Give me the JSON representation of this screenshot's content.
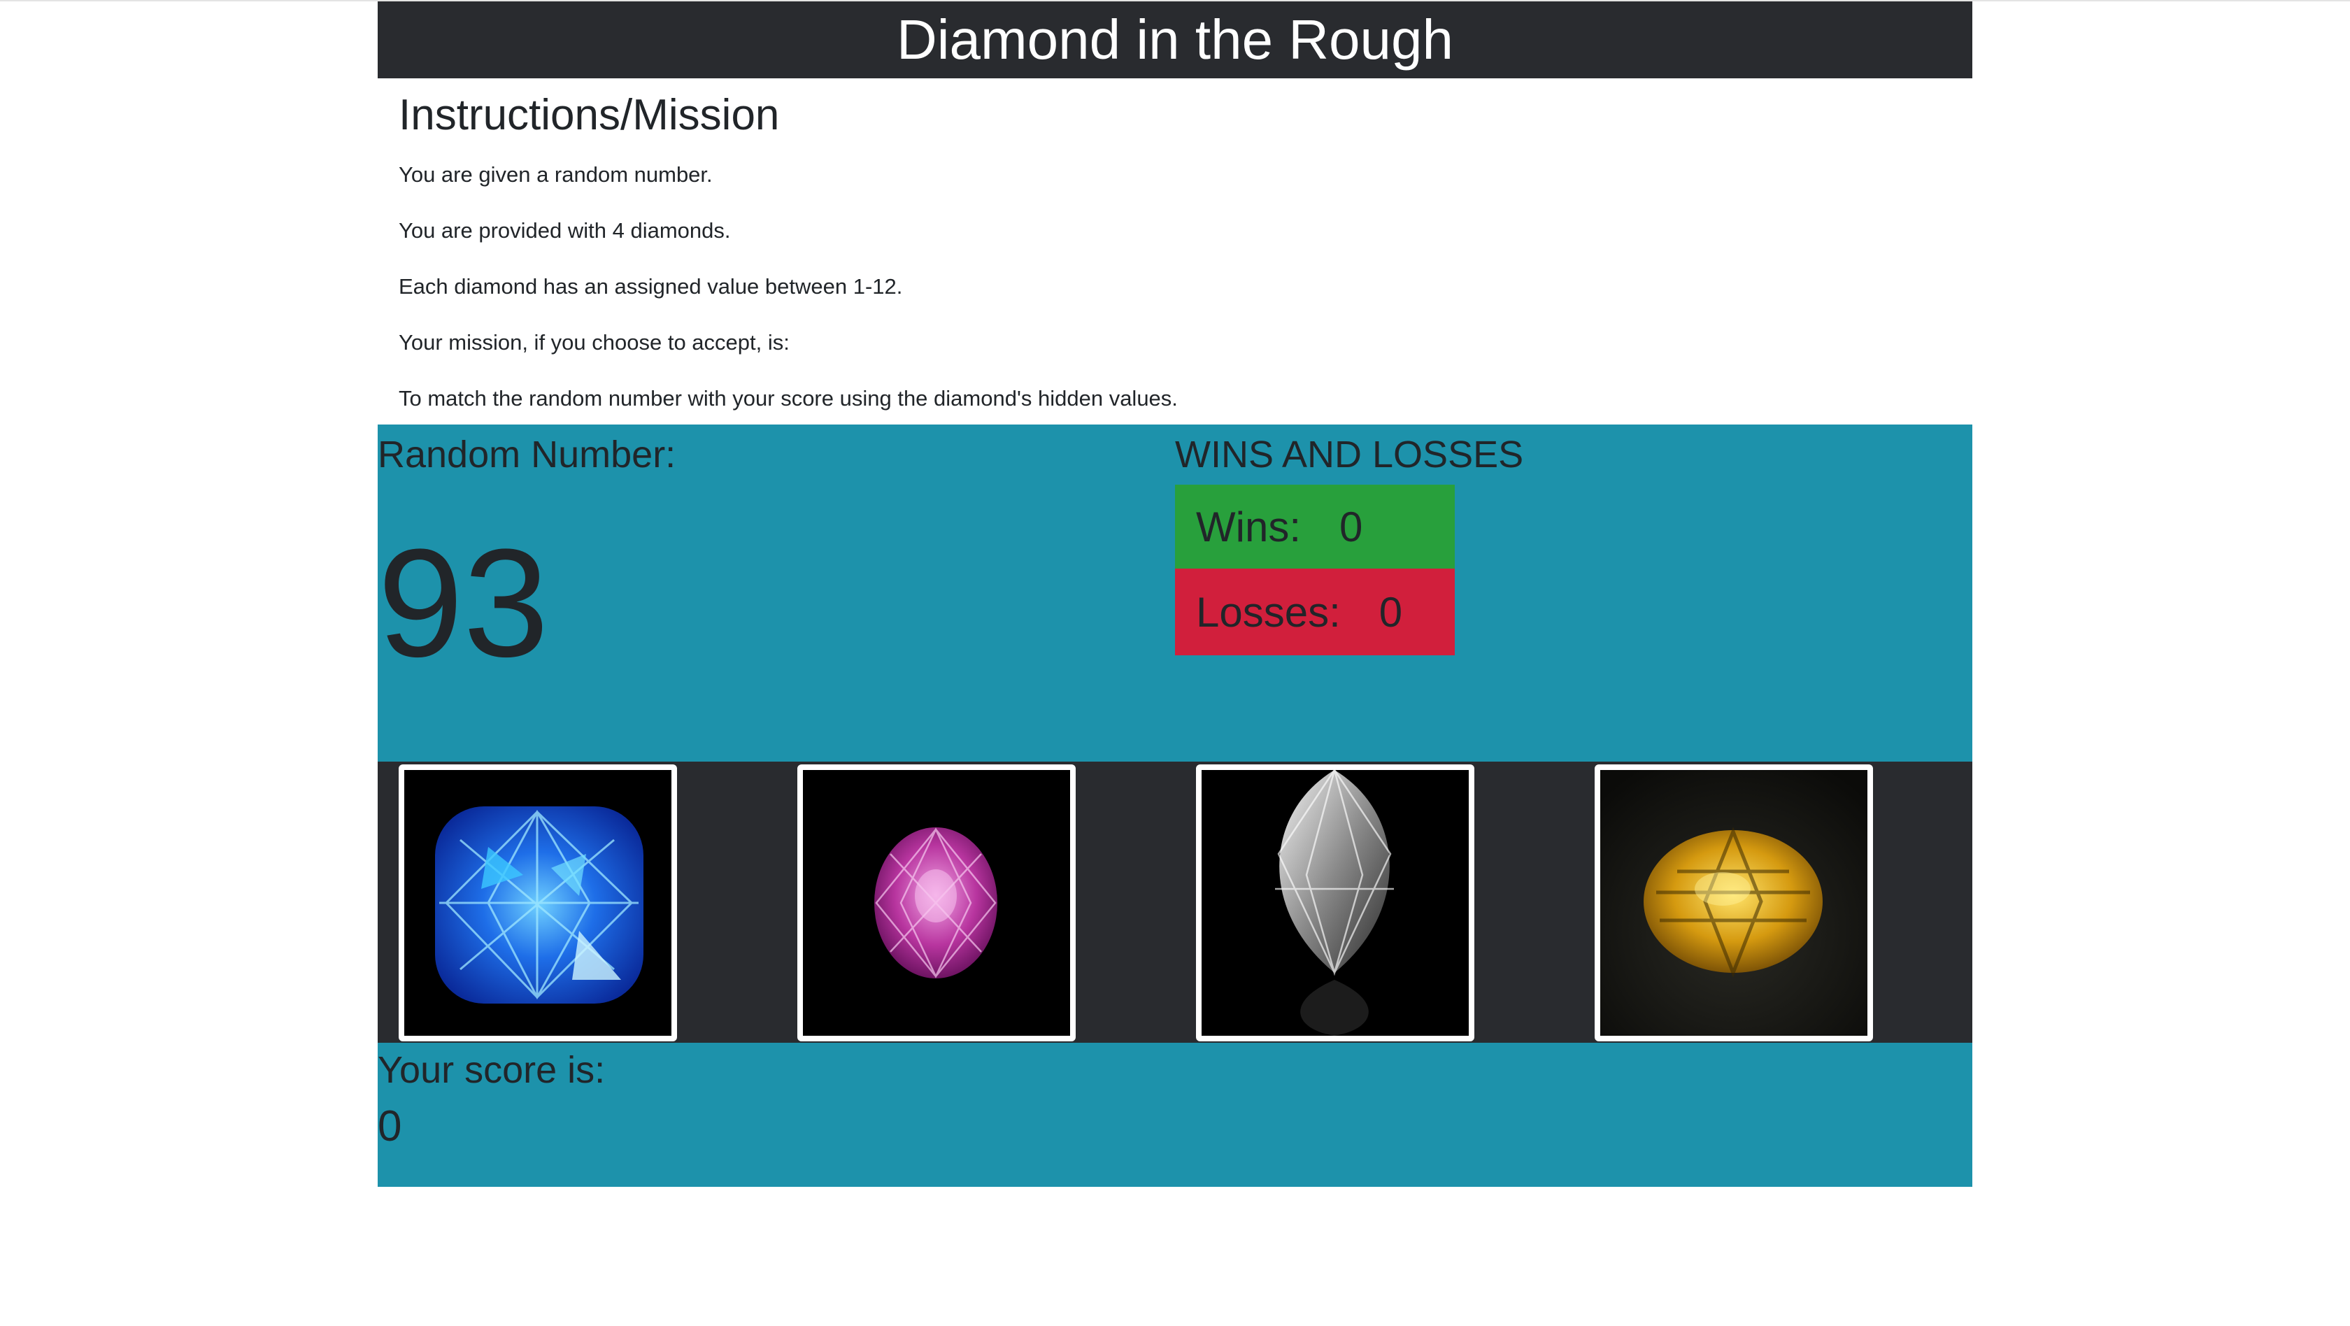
{
  "header": {
    "title": "Diamond in the Rough"
  },
  "instructions": {
    "heading": "Instructions/Mission",
    "lines": [
      "You are given a random number.",
      "You are provided with 4 diamonds.",
      "Each diamond has an assigned value between 1-12.",
      "Your mission, if you choose to accept, is:",
      "To match the random number with your score using the diamond's hidden values."
    ]
  },
  "random": {
    "label": "Random Number:",
    "value": "93"
  },
  "record": {
    "title": "WINS AND LOSSES",
    "wins_label": "Wins:",
    "wins_value": "0",
    "losses_label": "Losses:",
    "losses_value": "0"
  },
  "gems": [
    {
      "name": "blue-cushion-diamond"
    },
    {
      "name": "pink-oval-gem"
    },
    {
      "name": "clear-marquise-diamond"
    },
    {
      "name": "yellow-oval-sapphire"
    }
  ],
  "score": {
    "label": "Your score is:",
    "value": "0"
  },
  "colors": {
    "header_bg": "#292b2f",
    "panel_bg": "#1d92ab",
    "wins_bg": "#28a03c",
    "losses_bg": "#d11f3c"
  }
}
